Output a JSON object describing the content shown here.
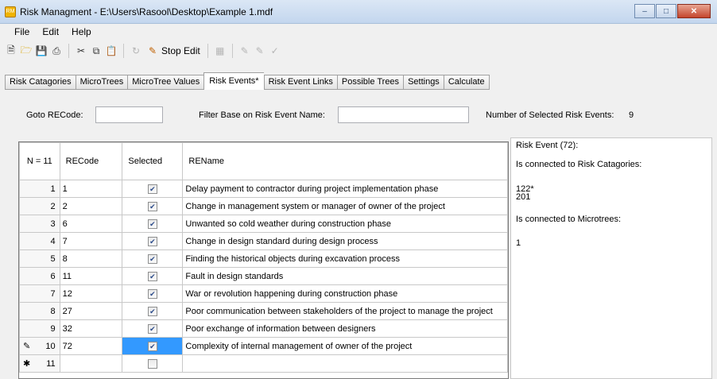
{
  "window": {
    "title": "Risk Managment - E:\\Users\\Rasool\\Desktop\\Example 1.mdf"
  },
  "menu": [
    "File",
    "Edit",
    "Help"
  ],
  "toolbar": {
    "stop_edit_label": "Stop Edit"
  },
  "tabs": [
    {
      "label": "Risk Catagories"
    },
    {
      "label": "MicroTrees"
    },
    {
      "label": "MicroTree Values"
    },
    {
      "label": "Risk Events*",
      "active": true
    },
    {
      "label": "Risk Event Links"
    },
    {
      "label": "Possible Trees"
    },
    {
      "label": "Settings"
    },
    {
      "label": "Calculate"
    }
  ],
  "filters": {
    "goto_label": "Goto RECode:",
    "goto_value": "",
    "filter_label": "Filter Base on Risk Event Name:",
    "filter_value": "",
    "count_label": "Number of Selected Risk Events:",
    "count_value": "9"
  },
  "grid": {
    "headers": {
      "n": "N = 11",
      "recode": "RECode",
      "selected": "Selected",
      "rename": "REName"
    },
    "rows": [
      {
        "n": "1",
        "recode": "1",
        "selected": true,
        "name": "Delay payment to contractor during project implementation phase"
      },
      {
        "n": "2",
        "recode": "2",
        "selected": true,
        "name": "Change in management system or manager of owner of the project"
      },
      {
        "n": "3",
        "recode": "6",
        "selected": true,
        "name": "Unwanted so cold weather during construction phase"
      },
      {
        "n": "4",
        "recode": "7",
        "selected": true,
        "name": "Change in design standard during design process"
      },
      {
        "n": "5",
        "recode": "8",
        "selected": true,
        "name": "Finding the historical objects during excavation process"
      },
      {
        "n": "6",
        "recode": "11",
        "selected": true,
        "name": "Fault in design standards"
      },
      {
        "n": "7",
        "recode": "12",
        "selected": true,
        "name": "War or revolution happening during construction phase"
      },
      {
        "n": "8",
        "recode": "27",
        "selected": true,
        "name": "Poor communication between stakeholders of the project to manage the project"
      },
      {
        "n": "9",
        "recode": "32",
        "selected": true,
        "name": "Poor exchange of information between designers"
      },
      {
        "n": "10",
        "recode": "72",
        "selected": true,
        "name": "Complexity of internal management of owner of the project",
        "editing": true
      },
      {
        "n": "11",
        "recode": "",
        "selected": false,
        "name": "",
        "new": true
      }
    ]
  },
  "details": {
    "title": "Risk Event (72):",
    "categories_label": "Is connected to Risk Catagories:",
    "categories": [
      "122*",
      "201"
    ],
    "microtrees_label": "Is connected to Microtrees:",
    "microtrees": [
      "1"
    ]
  },
  "icons": {
    "new": "new-file-icon",
    "open": "open-folder-icon",
    "save": "save-icon",
    "print": "print-icon",
    "cut": "cut-icon",
    "copy": "copy-icon",
    "paste": "paste-icon",
    "refresh": "refresh-icon",
    "stop_edit": "stop-edit-icon",
    "table": "table-icon",
    "edit_a": "edit-icon",
    "edit_b": "edit-alt-icon",
    "confirm": "check-icon",
    "row_editing": "pencil-icon",
    "row_new": "asterisk-icon"
  }
}
